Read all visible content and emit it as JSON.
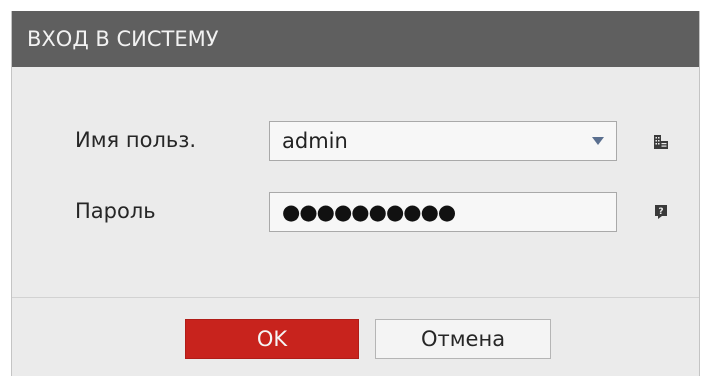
{
  "dialog": {
    "title": "ВХОД В СИСТЕМУ"
  },
  "form": {
    "username_label": "Имя польз.",
    "username_value": "admin",
    "password_label": "Пароль",
    "password_value": "●●●●●●●●●●"
  },
  "icons": {
    "username_side": "keyboard-icon",
    "password_side": "help-icon",
    "dropdown": "chevron-down-icon"
  },
  "buttons": {
    "ok_label": "OK",
    "cancel_label": "Отмена"
  },
  "colors": {
    "titlebar": "#5f5f5f",
    "dialog_bg": "#ebebeb",
    "ok_button": "#c8231d"
  }
}
